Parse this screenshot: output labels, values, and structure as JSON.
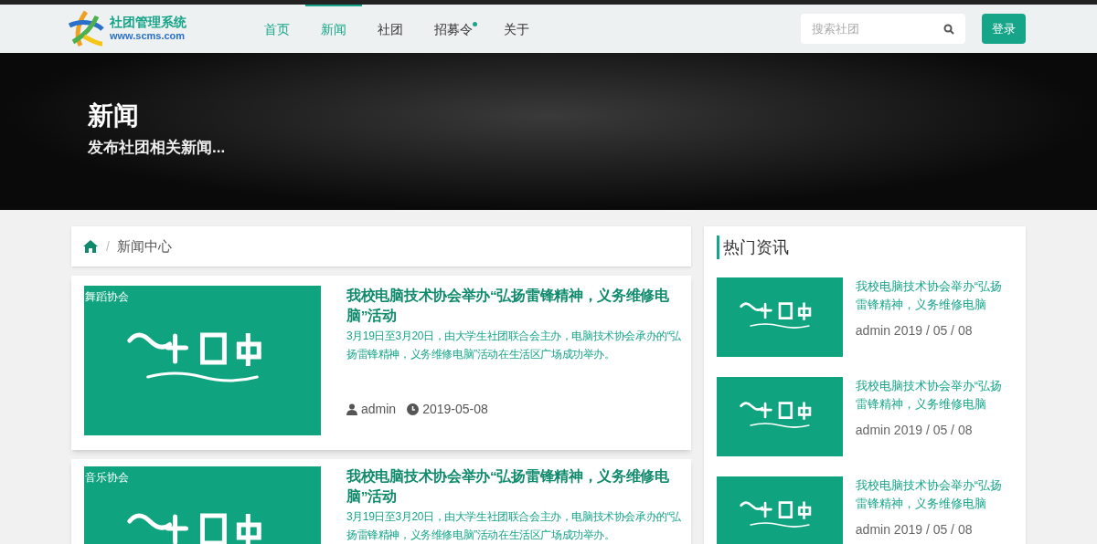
{
  "header": {
    "logo": {
      "title": "社团管理系统",
      "url": "www.scms.com"
    },
    "nav": [
      {
        "label": "首页",
        "selected": false,
        "hovered": true,
        "dot": false
      },
      {
        "label": "新闻",
        "selected": true,
        "hovered": false,
        "dot": false
      },
      {
        "label": "社团",
        "selected": false,
        "hovered": false,
        "dot": false
      },
      {
        "label": "招募令",
        "selected": false,
        "hovered": false,
        "dot": true
      },
      {
        "label": "关于",
        "selected": false,
        "hovered": false,
        "dot": false
      }
    ],
    "search": {
      "placeholder": "搜索社团"
    },
    "login": "登录"
  },
  "hero": {
    "title": "新闻",
    "subtitle": "发布社团相关新闻..."
  },
  "breadcrumb": {
    "separator": "/",
    "label": "新闻中心"
  },
  "news": [
    {
      "tag": "舞蹈协会",
      "title": "我校电脑技术协会举办“弘扬雷锋精神，义务维修电脑”活动",
      "summary": "3月19日至3月20日，由大学生社团联合会主办，电脑技术协会承办的“弘扬雷锋精神，义务维修电脑”活动在生活区广场成功举办。",
      "author": "admin",
      "date": "2019-05-08"
    },
    {
      "tag": "音乐协会",
      "title": "我校电脑技术协会举办“弘扬雷锋精神，义务维修电脑”活动",
      "summary": "3月19日至3月20日，由大学生社团联合会主办，电脑技术协会承办的“弘扬雷锋精神，义务维修电脑”活动在生活区广场成功举办。"
    }
  ],
  "hot": {
    "title": "热门资讯",
    "items": [
      {
        "title": "我校电脑技术协会举办“弘扬雷锋精神，义务维修电脑",
        "meta": "admin 2019 / 05 / 08"
      },
      {
        "title": "我校电脑技术协会举办“弘扬雷锋精神，义务维修电脑",
        "meta": "admin 2019 / 05 / 08"
      },
      {
        "title": "我校电脑技术协会举办“弘扬雷锋精神，义务维修电脑",
        "meta": "admin 2019 / 05 / 08"
      }
    ]
  }
}
